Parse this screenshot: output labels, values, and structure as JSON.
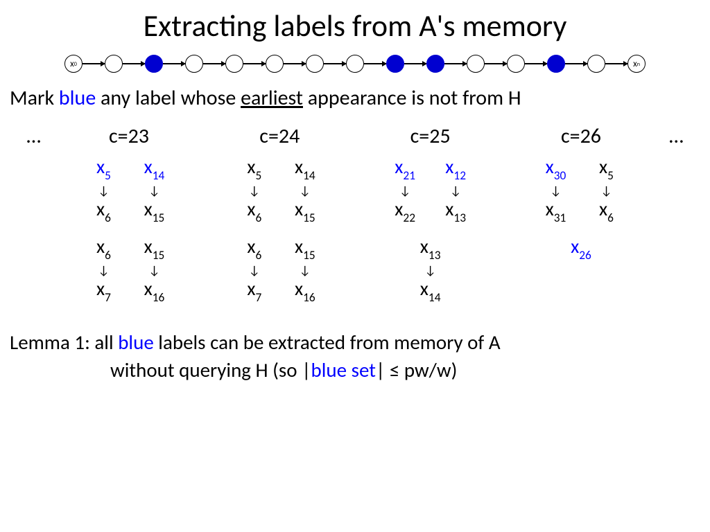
{
  "title": "Extracting labels from A's memory",
  "chain": {
    "start_label": "x",
    "start_sub": "0",
    "end_label": "x",
    "end_sub": "n",
    "nodes": [
      "label",
      "empty",
      "blue",
      "empty",
      "empty",
      "empty",
      "empty",
      "empty",
      "blue",
      "blue",
      "empty",
      "empty",
      "blue",
      "empty",
      "label"
    ]
  },
  "mark": {
    "pre": "Mark ",
    "blue": "blue",
    "mid": " any label whose ",
    "earliest": "earliest",
    "post": " appearance is not from H"
  },
  "ellipsis": "…",
  "columns": [
    {
      "header": "c=23",
      "rows": [
        {
          "top": [
            {
              "v": "x",
              "s": "5",
              "blue": true
            },
            {
              "v": "x",
              "s": "14",
              "blue": true
            }
          ],
          "bot": [
            {
              "v": "x",
              "s": "6"
            },
            {
              "v": "x",
              "s": "15"
            }
          ]
        },
        {
          "top": [
            {
              "v": "x",
              "s": "6"
            },
            {
              "v": "x",
              "s": "15"
            }
          ],
          "bot": [
            {
              "v": "x",
              "s": "7"
            },
            {
              "v": "x",
              "s": "16"
            }
          ]
        }
      ]
    },
    {
      "header": "c=24",
      "rows": [
        {
          "top": [
            {
              "v": "x",
              "s": "5"
            },
            {
              "v": "x",
              "s": "14"
            }
          ],
          "bot": [
            {
              "v": "x",
              "s": "6"
            },
            {
              "v": "x",
              "s": "15"
            }
          ]
        },
        {
          "top": [
            {
              "v": "x",
              "s": "6"
            },
            {
              "v": "x",
              "s": "15"
            }
          ],
          "bot": [
            {
              "v": "x",
              "s": "7"
            },
            {
              "v": "x",
              "s": "16"
            }
          ]
        }
      ]
    },
    {
      "header": "c=25",
      "rows": [
        {
          "top": [
            {
              "v": "x",
              "s": "21",
              "blue": true
            },
            {
              "v": "x",
              "s": "12",
              "blue": true
            }
          ],
          "bot": [
            {
              "v": "x",
              "s": "22"
            },
            {
              "v": "x",
              "s": "13"
            }
          ]
        },
        {
          "top": [
            {
              "v": "x",
              "s": "13"
            }
          ],
          "bot": [
            {
              "v": "x",
              "s": "14"
            }
          ]
        }
      ]
    },
    {
      "header": "c=26",
      "rows": [
        {
          "top": [
            {
              "v": "x",
              "s": "30",
              "blue": true
            },
            {
              "v": "x",
              "s": "5"
            }
          ],
          "bot": [
            {
              "v": "x",
              "s": "31"
            },
            {
              "v": "x",
              "s": "6"
            }
          ]
        }
      ],
      "single": {
        "v": "x",
        "s": "26",
        "blue": true
      }
    }
  ],
  "lemma": {
    "line1_pre": "Lemma 1: all ",
    "line1_blue": "blue",
    "line1_post": " labels can be extracted from memory of A",
    "line2_pre": "without querying H (so |",
    "line2_blue": "blue set",
    "line2_post": "| ≤ pw/w)"
  }
}
